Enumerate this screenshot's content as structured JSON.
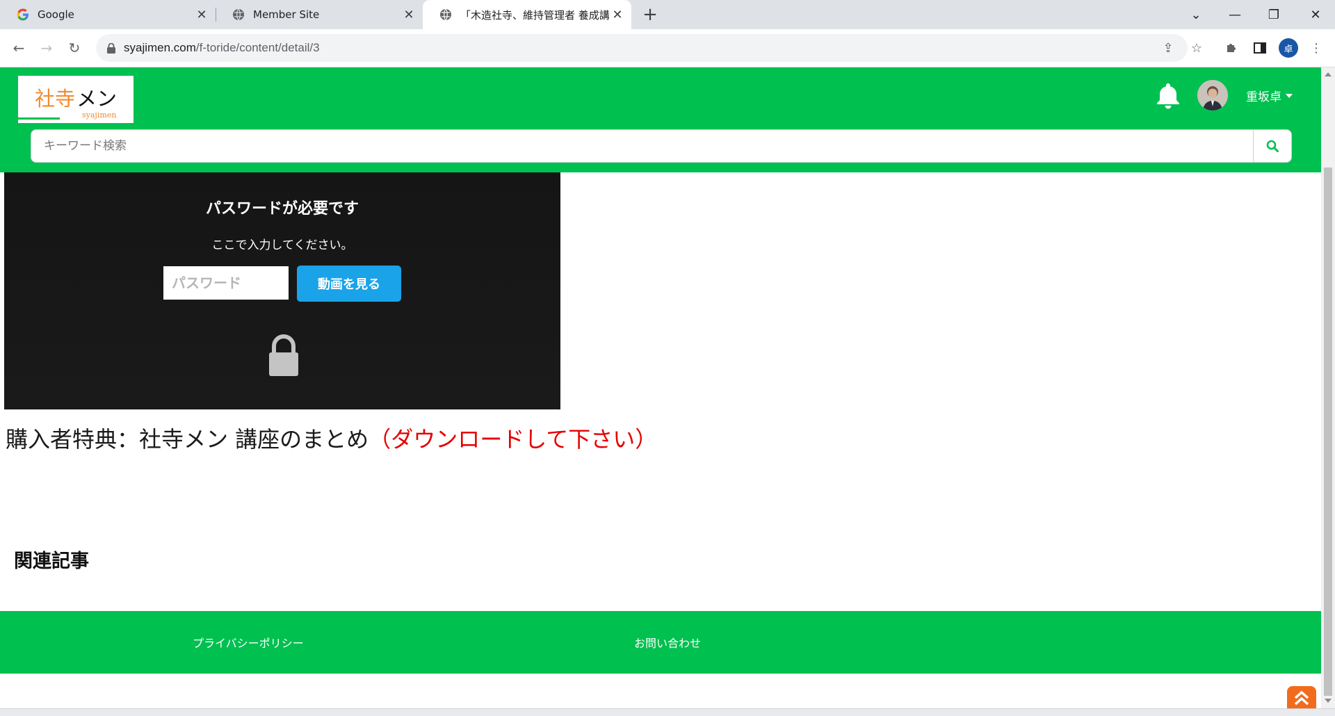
{
  "browser": {
    "tabs": [
      {
        "title": "Google",
        "active": false,
        "icon": "google-g-icon"
      },
      {
        "title": "Member Site",
        "active": false,
        "icon": "globe-icon"
      },
      {
        "title": "「木造社寺、維持管理者 養成講座",
        "active": true,
        "icon": "globe-icon"
      }
    ],
    "url_host": "syajimen.com",
    "url_path": "/f-toride/content/detail/3",
    "profile_initial": "卓"
  },
  "site": {
    "logo_part1": "社寺",
    "logo_part2": "メン",
    "logo_sub": "syajimen",
    "username": "重坂卓",
    "search_placeholder": "キーワード検索",
    "accent_color": "#00c050"
  },
  "video": {
    "title": "パスワードが必要です",
    "subtitle": "ここで入力してください。",
    "password_placeholder": "パスワード",
    "button_label": "動画を見る"
  },
  "content": {
    "headline_main": "購入者特典：社寺メン 講座のまとめ",
    "headline_red": "（ダウンロードして下さい）",
    "related_heading": "関連記事"
  },
  "footer": {
    "privacy_label": "プライバシーポリシー",
    "contact_label": "お問い合わせ"
  }
}
